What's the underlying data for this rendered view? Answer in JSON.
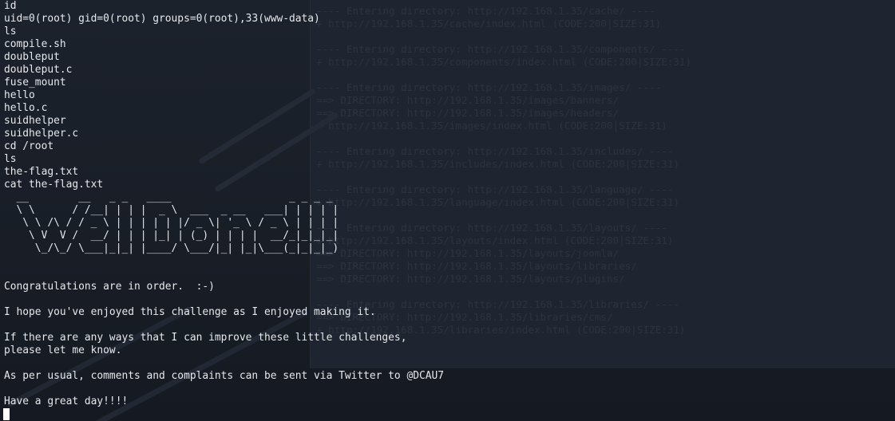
{
  "terminal": {
    "lines": [
      "id",
      "uid=0(root) gid=0(root) groups=0(root),33(www-data)",
      "ls",
      "compile.sh",
      "doubleput",
      "doubleput.c",
      "fuse_mount",
      "hello",
      "hello.c",
      "suidhelper",
      "suidhelper.c",
      "cd /root",
      "ls",
      "the-flag.txt",
      "cat the-flag.txt",
      "  __        __   _ _   ____                   _ _ _ _ ",
      "  \\ \\      / /__| | | |  _ \\  ___  _ __   ___| | | | |",
      "   \\ \\ /\\ / / _ \\ | | | | | |/ _ \\| '_ \\ / _ \\ | | | |",
      "    \\ V  V /  __/ | | | |_| | (_) | | | |  __/_|_|_|_|",
      "     \\_/\\_/ \\___|_|_| |____/ \\___/|_| |_|\\___(_|_|_|_)",
      "",
      "",
      "Congratulations are in order.  :-)",
      "",
      "I hope you've enjoyed this challenge as I enjoyed making it.",
      "",
      "If there are any ways that I can improve these little challenges,",
      "please let me know.",
      "",
      "As per usual, comments and complaints can be sent via Twitter to @DCAU7",
      "",
      "Have a great day!!!!"
    ]
  },
  "background_terminal": {
    "lines": [
      "---- Entering directory: http://192.168.1.35/cache/ ----",
      "+ http://192.168.1.35/cache/index.html (CODE:200|SIZE:31)",
      "",
      "---- Entering directory: http://192.168.1.35/components/ ----",
      "+ http://192.168.1.35/components/index.html (CODE:200|SIZE:31)",
      "",
      "---- Entering directory: http://192.168.1.35/images/ ----",
      "==> DIRECTORY: http://192.168.1.35/images/banners/",
      "==> DIRECTORY: http://192.168.1.35/images/headers/",
      "+ http://192.168.1.35/images/index.html (CODE:200|SIZE:31)",
      "",
      "---- Entering directory: http://192.168.1.35/includes/ ----",
      "+ http://192.168.1.35/includes/index.html (CODE:200|SIZE:31)",
      "",
      "---- Entering directory: http://192.168.1.35/language/ ----",
      "+ http://192.168.1.35/language/index.html (CODE:200|SIZE:31)",
      "",
      "---- Entering directory: http://192.168.1.35/layouts/ ----",
      "+ http://192.168.1.35/layouts/index.html (CODE:200|SIZE:31)",
      "==> DIRECTORY: http://192.168.1.35/layouts/joomla/",
      "==> DIRECTORY: http://192.168.1.35/layouts/libraries/",
      "==> DIRECTORY: http://192.168.1.35/layouts/plugins/",
      "",
      "---- Entering directory: http://192.168.1.35/libraries/ ----",
      "==> DIRECTORY: http://192.168.1.35/libraries/cms/",
      "+ http://192.168.1.35/libraries/index.html (CODE:200|SIZE:31)"
    ]
  },
  "colors": {
    "background": "#1a1f29",
    "text": "#e6e8ec",
    "cursor": "#ffffff"
  },
  "icons": {
    "cursor": "block-cursor-icon"
  }
}
